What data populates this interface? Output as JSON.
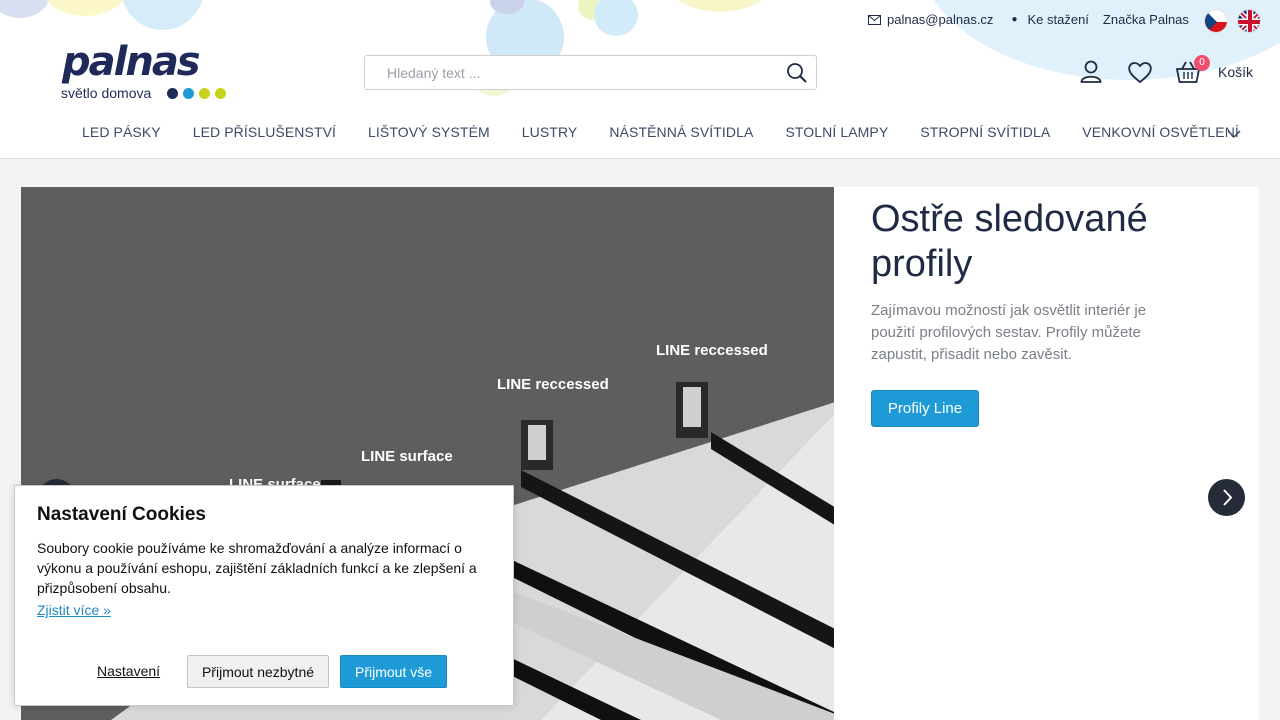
{
  "colors": {
    "brand_navy": "#1f2a5a",
    "accent_blue": "#1e9bd7",
    "badge_pink": "#f0506e",
    "logo_dots": [
      "#1f2a5a",
      "#1e9bd7",
      "#c7d21a",
      "#c7d21a"
    ]
  },
  "header": {
    "email": "palnas@palnas.cz",
    "links": [
      "Ke stažení",
      "Značka Palnas"
    ],
    "languages": [
      "cs",
      "en"
    ],
    "logo_word": "palnas",
    "logo_tagline": "světlo domova",
    "search_placeholder": "Hledaný text ...",
    "cart_count": "0",
    "cart_label": "Košík",
    "icons": [
      "mail-icon",
      "search-icon",
      "user-icon",
      "heart-icon",
      "basket-icon",
      "chevron-down-icon"
    ]
  },
  "nav": {
    "items": [
      "LED PÁSKY",
      "LED PŘÍSLUŠENSTVÍ",
      "LIŠTOVÝ SYSTÉM",
      "LUSTRY",
      "NÁSTĚNNÁ SVÍTIDLA",
      "STOLNÍ LAMPY",
      "STROPNÍ SVÍTIDLA",
      "VENKOVNÍ OSVĚTLENÍ"
    ]
  },
  "slide": {
    "title": "Ostře sledované profily",
    "text": "Zajímavou možností jak osvětlit interiér je použití profilových sestav. Profily můžete zapustit, přisadit nebo zavěsit.",
    "button": "Profily Line",
    "image_labels": [
      "LINE reccessed",
      "LINE reccessed",
      "LINE surface",
      "LINE surface"
    ]
  },
  "cookie": {
    "title": "Nastavení Cookies",
    "text": "Soubory cookie používáme ke shromažďování a analýze informací o výkonu a používání eshopu, zajištění základních funkcí a ke zlepšení a přizpůsobení obsahu.",
    "more_link": "Zjistit více »",
    "settings_link": "Nastavení",
    "accept_necessary": "Přijmout nezbytné",
    "accept_all": "Přijmout vše"
  }
}
